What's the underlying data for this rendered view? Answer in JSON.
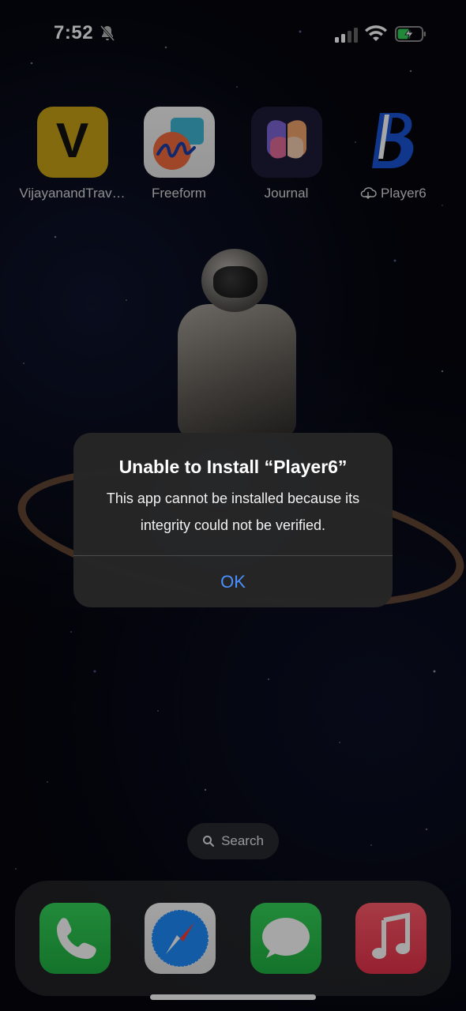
{
  "status": {
    "time": "7:52",
    "icons": [
      "bell-slash-icon",
      "signal-icon",
      "wifi-icon",
      "battery-charging-icon"
    ]
  },
  "apps": [
    {
      "label": "VijayanandTrav…",
      "icon": "V"
    },
    {
      "label": "Freeform",
      "icon": "freeform-icon"
    },
    {
      "label": "Journal",
      "icon": "journal-icon"
    },
    {
      "label": "Player6",
      "icon": "b-logo-icon",
      "badge": "cloud-download-icon"
    }
  ],
  "search": {
    "label": "Search"
  },
  "dock": [
    "phone-icon",
    "safari-icon",
    "messages-icon",
    "music-icon"
  ],
  "alert": {
    "title": "Unable to Install “Player6”",
    "message": "This app cannot be installed because its integrity could not be verified.",
    "ok_label": "OK"
  },
  "colors": {
    "accent": "#4a90ff",
    "vijayanand_icon": "#caa418"
  }
}
